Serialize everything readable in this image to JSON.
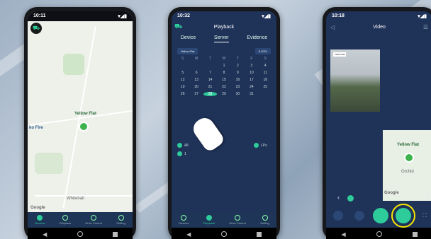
{
  "phone1": {
    "status_time": "10:11",
    "map_label": "Yellow Flat",
    "map_label_2": "ko Fire",
    "map_label_3": "Whitehall",
    "google": "Google",
    "tabs": [
      "Devices",
      "Playback",
      "Drive Control",
      "Setting"
    ],
    "active_tab": 0
  },
  "phone2": {
    "status_time": "10:32",
    "title": "Playback",
    "segments": [
      "Device",
      "Server",
      "Evidence"
    ],
    "selected_segment": 1,
    "picker_left": "Yellow Flat",
    "picker_right": "8 2021",
    "cal_rows": [
      [
        "S",
        "M",
        "T",
        "W",
        "T",
        "F",
        "S"
      ],
      [
        "",
        "",
        "",
        "1",
        "2",
        "3",
        "4"
      ],
      [
        "5",
        "6",
        "7",
        "8",
        "9",
        "10",
        "11"
      ],
      [
        "12",
        "13",
        "14",
        "15",
        "16",
        "17",
        "18"
      ],
      [
        "19",
        "20",
        "21",
        "22",
        "23",
        "24",
        "25"
      ],
      [
        "26",
        "27",
        "28",
        "29",
        "30",
        "31",
        ""
      ],
      [
        "",
        "",
        "",
        "",
        "",
        "",
        ""
      ]
    ],
    "today": "28",
    "opt_all": "All",
    "opt_1": "1",
    "opt_lps": "LPs",
    "tabs": [
      "Devices",
      "Playback",
      "Drive Control",
      "Setting"
    ],
    "active_tab": 1
  },
  "phone3": {
    "status_time": "10:18",
    "title": "Video",
    "video_tag": "Yellow Flat",
    "map_label": "Yellow Flat",
    "map_sub": "Orchid",
    "google": "Google"
  },
  "colors": {
    "accent": "#2ecc9a",
    "panel": "#1f3258",
    "highlight": "#f5e600"
  }
}
